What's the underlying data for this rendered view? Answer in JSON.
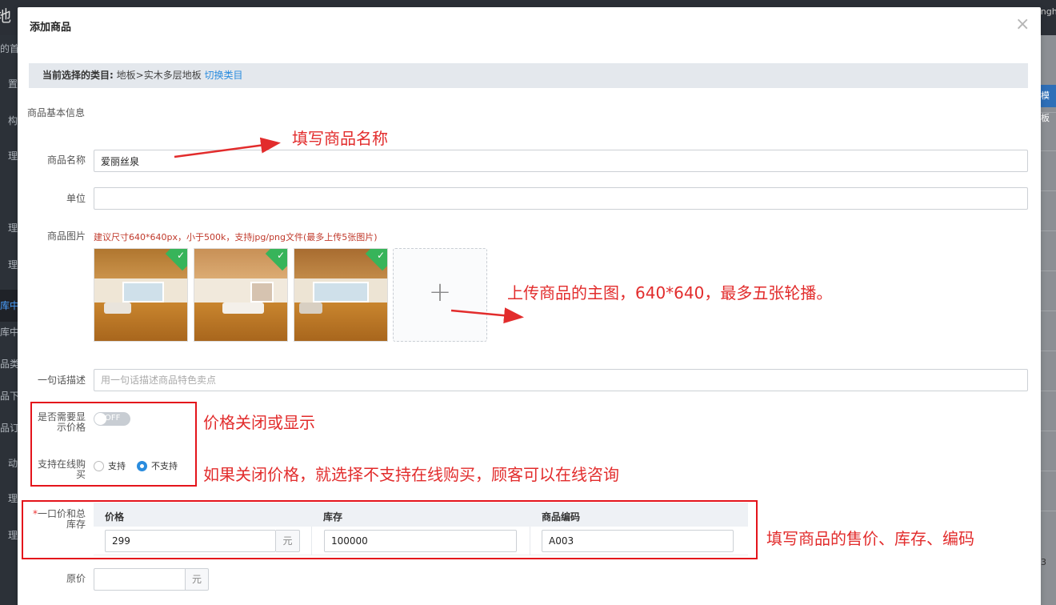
{
  "background": {
    "logo_fragment": "地",
    "user_fragment": "engh",
    "right_button_fragment": "模板",
    "page_fragment": "3",
    "sidebar_fragments": [
      "的首",
      "置",
      "构",
      "理",
      "理",
      "理",
      "库中",
      "库中",
      "品类",
      "品下",
      "品订",
      "动",
      "理",
      "理"
    ]
  },
  "modal": {
    "title": "添加商品",
    "close_icon": "close-icon",
    "category_bar": {
      "label": "当前选择的类目:",
      "path": "地板>实木多层地板",
      "switch_link": "切换类目"
    },
    "section_basic": "商品基本信息",
    "name": {
      "label": "商品名称",
      "value": "爱丽丝泉"
    },
    "unit": {
      "label": "单位",
      "value": ""
    },
    "images": {
      "label": "商品图片",
      "hint": "建议尺寸640*640px，小于500k，支持jpg/png文件(最多上传5张图片)",
      "thumbnails": [
        "room-photo-1",
        "room-photo-2",
        "room-photo-3"
      ],
      "upload_icon": "plus-icon",
      "upload_symbol": "+"
    },
    "description": {
      "label": "一句话描述",
      "placeholder": "用一句话描述商品特色卖点"
    },
    "show_price": {
      "label": "是否需要显示价格",
      "toggle_text": "OFF",
      "state": "off"
    },
    "online_buy": {
      "label": "支持在线购买",
      "option_yes": "支持",
      "option_no": "不支持",
      "selected": "不支持"
    },
    "price_table": {
      "required_mark": "*",
      "label": "一口价和总库存",
      "columns": [
        "价格",
        "库存",
        "商品编码"
      ],
      "price_value": "299",
      "price_unit": "元",
      "stock_value": "100000",
      "code_value": "A003"
    },
    "original_price": {
      "label": "原价",
      "value": "",
      "unit": "元"
    }
  },
  "annotations": {
    "name_note": "填写商品名称",
    "image_note": "上传商品的主图，640*640，最多五张轮播。",
    "price_toggle_note": "价格关闭或显示",
    "online_note": "如果关闭价格，就选择不支持在线购买，顾客可以在线咨询",
    "table_note": "填写商品的售价、库存、编码",
    "color": "#e22c2c"
  }
}
